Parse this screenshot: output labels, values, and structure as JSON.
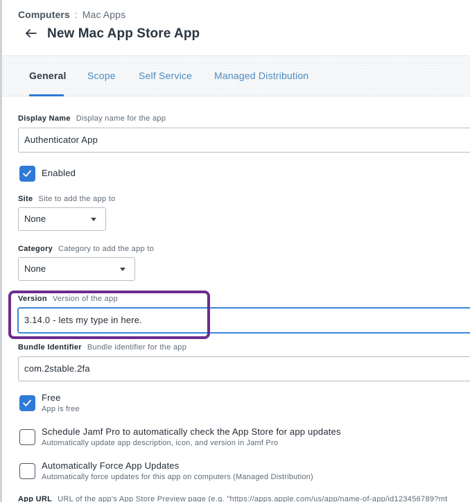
{
  "breadcrumb": {
    "root": "Computers",
    "separator": ":",
    "current": "Mac Apps"
  },
  "header": {
    "back_icon": "arrow-left-icon",
    "title": "New Mac App Store App"
  },
  "tabs": [
    {
      "label": "General",
      "active": true
    },
    {
      "label": "Scope",
      "active": false
    },
    {
      "label": "Self Service",
      "active": false
    },
    {
      "label": "Managed Distribution",
      "active": false
    }
  ],
  "form": {
    "display_name": {
      "label": "Display Name",
      "hint": "Display name for the app",
      "value": "Authenticator App"
    },
    "enabled": {
      "label": "Enabled",
      "checked": true
    },
    "site": {
      "label": "Site",
      "hint": "Site to add the app to",
      "value": "None"
    },
    "category": {
      "label": "Category",
      "hint": "Category to add the app to",
      "value": "None"
    },
    "version": {
      "label": "Version",
      "hint": "Version of the app",
      "value": "3.14.0 - lets my type in here."
    },
    "bundle_id": {
      "label": "Bundle Identifier",
      "hint": "Bundle identifier for the app",
      "value": "com.2stable.2fa"
    },
    "free": {
      "label": "Free",
      "sub": "App is free",
      "checked": true
    },
    "auto_check": {
      "label": "Schedule Jamf Pro to automatically check the App Store for app updates",
      "sub": "Automatically update app description, icon, and version in Jamf Pro",
      "checked": false
    },
    "force_updates": {
      "label": "Automatically Force App Updates",
      "sub": "Automatically force updates for this app on computers (Managed Distribution)",
      "checked": false
    },
    "app_url": {
      "label": "App URL",
      "hint": "URL of the app's App Store Preview page (e.g. \"https://apps.apple.com/us/app/name-of-app/id123456789?mt"
    }
  },
  "colors": {
    "accent": "#2f7ad6",
    "annotation": "#6a2d8c",
    "tab_link": "#4a8bc2"
  }
}
